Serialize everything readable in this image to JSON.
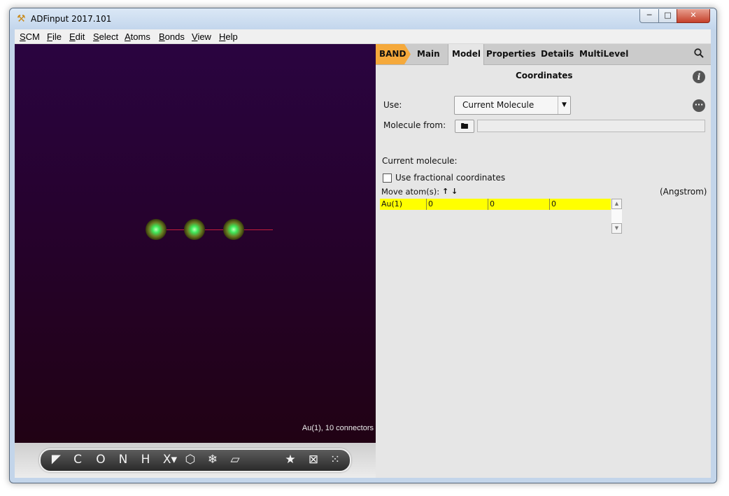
{
  "window": {
    "title": "ADFinput 2017.101",
    "minimize_glyph": "─",
    "maximize_glyph": "□",
    "close_glyph": "✕"
  },
  "menubar": {
    "items": [
      "SCM",
      "File",
      "Edit",
      "Select",
      "Atoms",
      "Bonds",
      "View",
      "Help"
    ]
  },
  "viewer": {
    "status": "Au(1), 10 connectors",
    "background_top": "#2a0440",
    "background_bottom": "#200210",
    "atom_color": "#3fe85a",
    "bond_color": "#c41c3c"
  },
  "toolbar": {
    "tools": [
      {
        "name": "select-tool",
        "glyph": "◣"
      },
      {
        "name": "carbon-tool",
        "glyph": "C"
      },
      {
        "name": "oxygen-tool",
        "glyph": "O"
      },
      {
        "name": "nitrogen-tool",
        "glyph": "N"
      },
      {
        "name": "hydrogen-tool",
        "glyph": "H"
      },
      {
        "name": "element-picker-tool",
        "glyph": "X▾"
      },
      {
        "name": "ring-tool",
        "glyph": "⬡"
      },
      {
        "name": "snowflake-tool",
        "glyph": "❄"
      },
      {
        "name": "plane-tool",
        "glyph": "▱"
      },
      {
        "name": "favorite-tool",
        "glyph": "★"
      },
      {
        "name": "box-tool",
        "glyph": "⊠"
      },
      {
        "name": "cluster-tool",
        "glyph": "⁙"
      }
    ]
  },
  "panel": {
    "tabs": {
      "band": "BAND",
      "main": "Main",
      "model": "Model",
      "properties": "Properties",
      "details": "Details",
      "multilevel": "MultiLevel"
    },
    "active_tab": "Model",
    "accent_color": "#f5a93b",
    "section_title": "Coordinates",
    "info_glyph": "i",
    "more_glyph": "···",
    "use_label": "Use:",
    "use_value": "Current Molecule",
    "molecule_from_label": "Molecule from:",
    "molecule_from_value": "",
    "current_molecule_label": "Current molecule:",
    "fractional_label": "Use fractional coordinates",
    "fractional_checked": false,
    "move_atoms_label": "Move atom(s):",
    "move_arrows": "↑ ↓",
    "units": "(Angstrom)",
    "coordinates": [
      {
        "atom": "Au(1)",
        "x": "0",
        "y": "0",
        "z": "0"
      }
    ]
  }
}
